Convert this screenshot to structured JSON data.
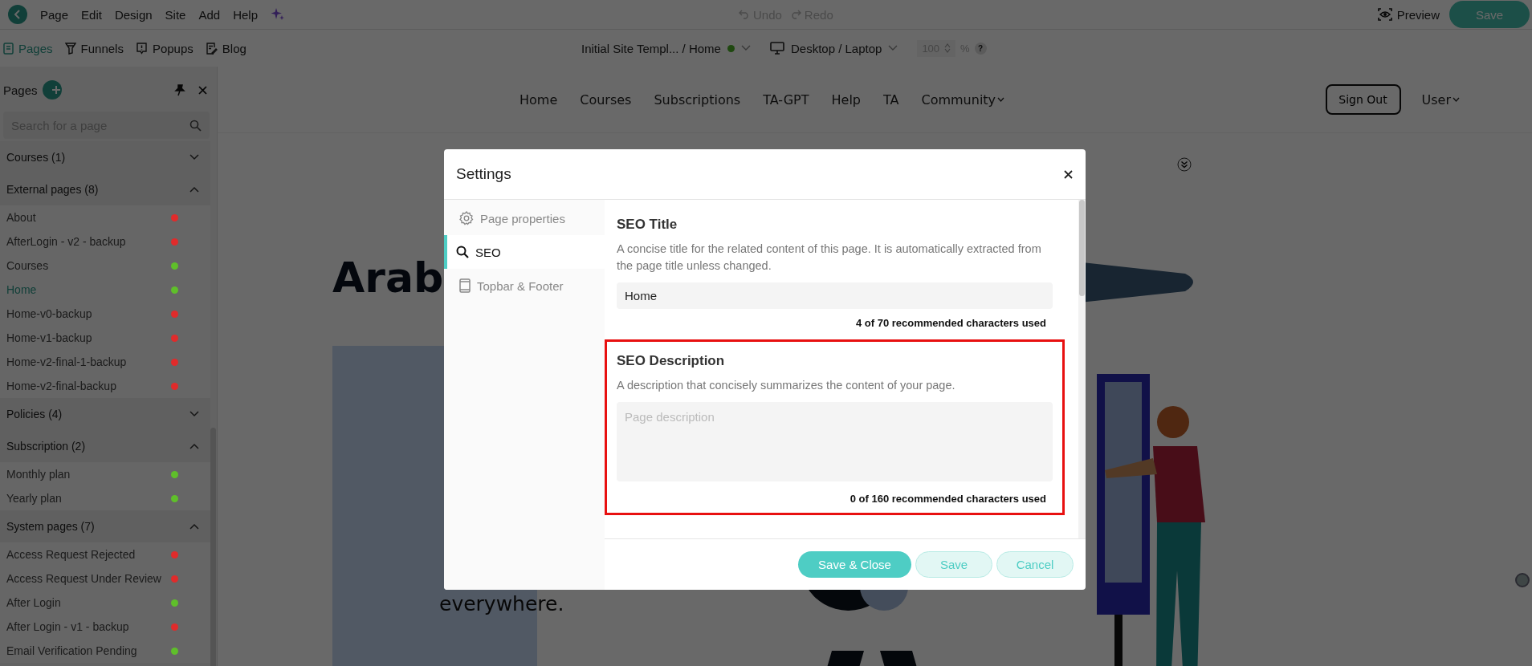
{
  "menu": {
    "items": [
      "Page",
      "Edit",
      "Design",
      "Site",
      "Add",
      "Help"
    ]
  },
  "history": [
    {
      "label": "Undo",
      "kind": "undo",
      "disabled": true
    },
    {
      "label": "Redo",
      "kind": "redo",
      "disabled": true
    }
  ],
  "actions": {
    "preview": "Preview",
    "save": "Save"
  },
  "toolbar": {
    "tabs": [
      {
        "label": "Pages",
        "kind": "pages",
        "selected": true
      },
      {
        "label": "Funnels",
        "kind": "funnels",
        "selected": false
      },
      {
        "label": "Popups",
        "kind": "popups",
        "selected": false
      },
      {
        "label": "Blog",
        "kind": "blog",
        "selected": false
      }
    ],
    "site": {
      "label": "Initial Site Templ... / Home",
      "published": true
    },
    "device": "Desktop / Laptop",
    "zoom": {
      "value": "100",
      "unit": "%",
      "help": "?"
    }
  },
  "sidebar": {
    "title": "Pages",
    "search": {
      "placeholder": "Search for a page"
    },
    "groups": [
      {
        "label": "Courses (1)",
        "expanded": false
      },
      {
        "label": "External pages (8)",
        "expanded": true,
        "items": [
          {
            "label": "About",
            "selected": false,
            "color": "#e02b2b"
          },
          {
            "label": "AfterLogin - v2 - backup",
            "selected": false,
            "color": "#e02b2b"
          },
          {
            "label": "Courses",
            "selected": false,
            "color": "#5fbf2a"
          },
          {
            "label": "Home",
            "selected": true,
            "color": "#5fbf2a"
          },
          {
            "label": "Home-v0-backup",
            "selected": false,
            "color": "#e02b2b"
          },
          {
            "label": "Home-v1-backup",
            "selected": false,
            "color": "#e02b2b"
          },
          {
            "label": "Home-v2-final-1-backup",
            "selected": false,
            "color": "#e02b2b"
          },
          {
            "label": "Home-v2-final-backup",
            "selected": false,
            "color": "#e02b2b"
          }
        ]
      },
      {
        "label": "Policies (4)",
        "expanded": false
      },
      {
        "label": "Subscription (2)",
        "expanded": true,
        "items": [
          {
            "label": "Monthly plan",
            "selected": false,
            "color": "#5fbf2a"
          },
          {
            "label": "Yearly plan",
            "selected": false,
            "color": "#5fbf2a"
          }
        ]
      },
      {
        "label": "System pages (7)",
        "expanded": true,
        "items": [
          {
            "label": "Access Request Rejected",
            "selected": false,
            "color": "#e02b2b"
          },
          {
            "label": "Access Request Under Review",
            "selected": false,
            "color": "#e02b2b"
          },
          {
            "label": "After Login",
            "selected": false,
            "color": "#5fbf2a"
          },
          {
            "label": "After Login - v1 - backup",
            "selected": false,
            "color": "#e02b2b"
          },
          {
            "label": "Email Verification Pending",
            "selected": false,
            "color": "#5fbf2a"
          }
        ]
      }
    ]
  },
  "site_page": {
    "nav": [
      "Home",
      "Courses",
      "Subscriptions",
      "TA-GPT",
      "Help",
      "TA"
    ],
    "dropdown": "Community",
    "sign_out": "Sign Out",
    "user": "User",
    "hero_title": "Arab",
    "hero_tail": "everywhere."
  },
  "dialog": {
    "title": "Settings",
    "nav": [
      {
        "label": "Page properties",
        "kind": "gear",
        "selected": false
      },
      {
        "label": "SEO",
        "kind": "search",
        "selected": true
      },
      {
        "label": "Topbar & Footer",
        "kind": "phone",
        "selected": false
      }
    ],
    "sections": [
      {
        "title": "SEO Title",
        "description": "A concise title for the related content of this page. It is automatically extracted from the page title unless changed.",
        "kind": "input",
        "value": "Home",
        "counter": "4 of 70 recommended characters used",
        "highlighted": false
      },
      {
        "title": "SEO Description",
        "description": "A description that concisely summarizes the content of your page.",
        "kind": "textarea",
        "placeholder": "Page description",
        "counter": "0 of 160 recommended characters used",
        "highlighted": true
      }
    ],
    "buttons": [
      {
        "label": "Save & Close",
        "kind": "primary"
      },
      {
        "label": "Save",
        "kind": "secondary"
      },
      {
        "label": "Cancel",
        "kind": "secondary"
      }
    ]
  }
}
